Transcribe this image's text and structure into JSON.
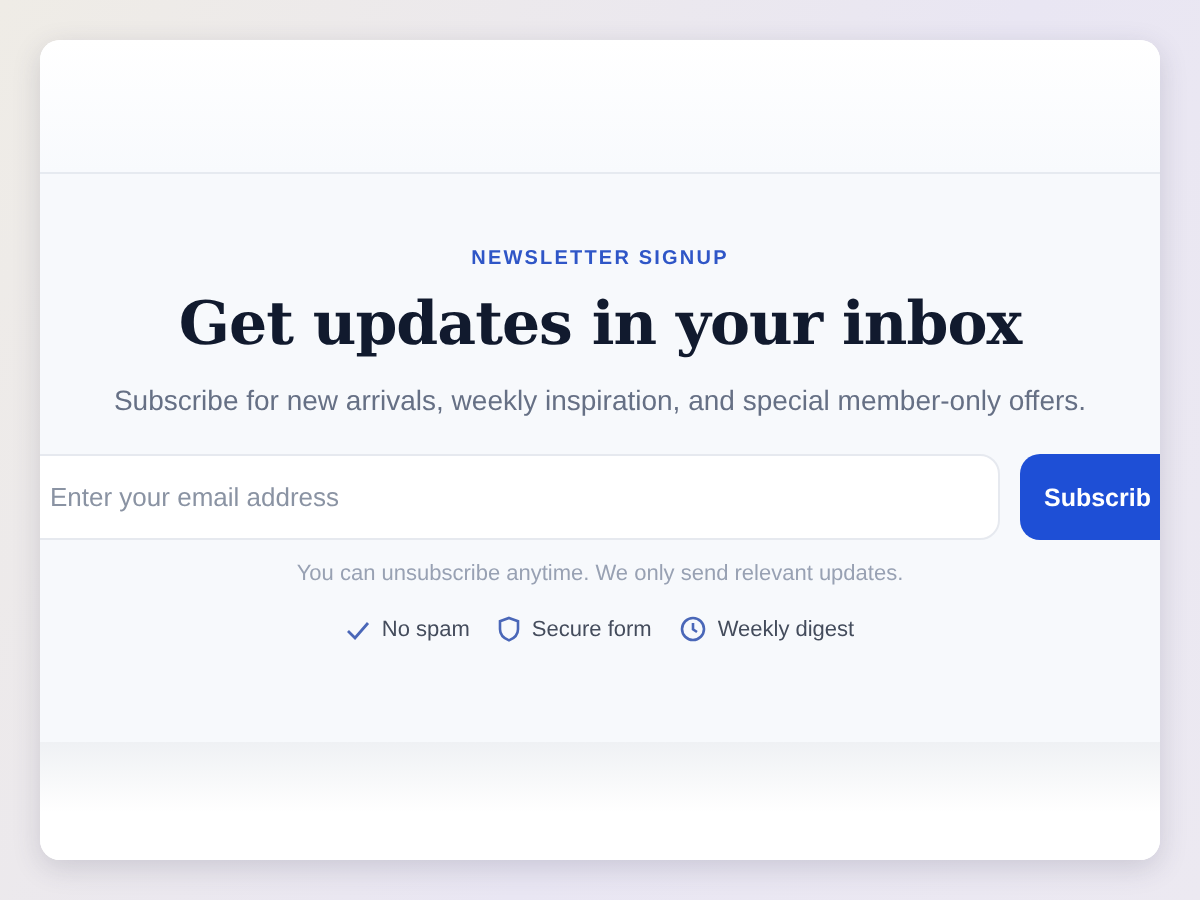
{
  "eyebrow": "NEWSLETTER SIGNUP",
  "title": "Get updates in your inbox",
  "subtitle": "Subscribe for new arrivals, weekly inspiration, and special member-only offers.",
  "email_field": {
    "placeholder": "Enter your email address"
  },
  "subscribe_button": "Subscrib",
  "note": "You can unsubscribe anytime. We only send relevant updates.",
  "features": [
    {
      "kind": "check",
      "label": "No spam"
    },
    {
      "kind": "shield",
      "label": "Secure form"
    },
    {
      "kind": "clock",
      "label": "Weekly digest"
    }
  ]
}
